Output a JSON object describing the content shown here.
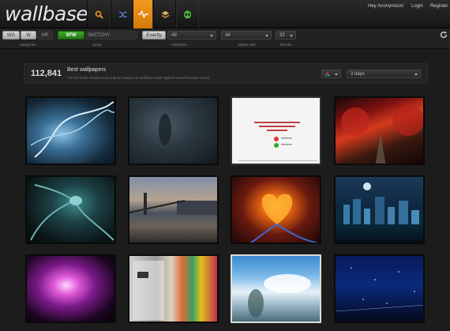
{
  "topbar": {
    "logo": "wallbase",
    "greeting": "Hey Anonymous!",
    "login": "Login",
    "register": "Register",
    "nav_icons": [
      "search-icon",
      "shuffle-icon",
      "activity-icon",
      "toplist-icon",
      "alien-icon"
    ],
    "accent": "#f39a1e"
  },
  "filters": {
    "categories": [
      "WG",
      "W",
      "HR"
    ],
    "categories_caption": "categories",
    "purity": [
      "SFW",
      "SKETCHY"
    ],
    "purity_caption": "purity",
    "resolution_mode": "Exactly",
    "resolution_value": "All",
    "resolution_caption": "resolution",
    "aspect_value": "All",
    "aspect_caption": "aspect ratio",
    "thumbs_value": "32",
    "thumbs_caption": "thumbs"
  },
  "listing": {
    "count": "112,841",
    "title": "Best wallpapers",
    "description": "The list below shows most popular images on wallbase (with highest views/favorites count)",
    "period": "3 days"
  },
  "thumbnails": [
    {
      "name": "thumb-dna",
      "desc": "dna helix"
    },
    {
      "name": "thumb-dark-figure",
      "desc": "dark figure"
    },
    {
      "name": "thumb-document",
      "desc": "white document"
    },
    {
      "name": "thumb-red-forest",
      "desc": "red forest road"
    },
    {
      "name": "thumb-tentacles",
      "desc": "tentacle creature"
    },
    {
      "name": "thumb-bridge",
      "desc": "bridge city"
    },
    {
      "name": "thumb-fire-heart",
      "desc": "fire heart"
    },
    {
      "name": "thumb-night-city",
      "desc": "night city"
    },
    {
      "name": "thumb-nebula",
      "desc": "nebula"
    },
    {
      "name": "thumb-anime-collage",
      "desc": "anime collage"
    },
    {
      "name": "thumb-anime-sky",
      "desc": "anime sky"
    },
    {
      "name": "thumb-stars",
      "desc": "star field"
    }
  ]
}
